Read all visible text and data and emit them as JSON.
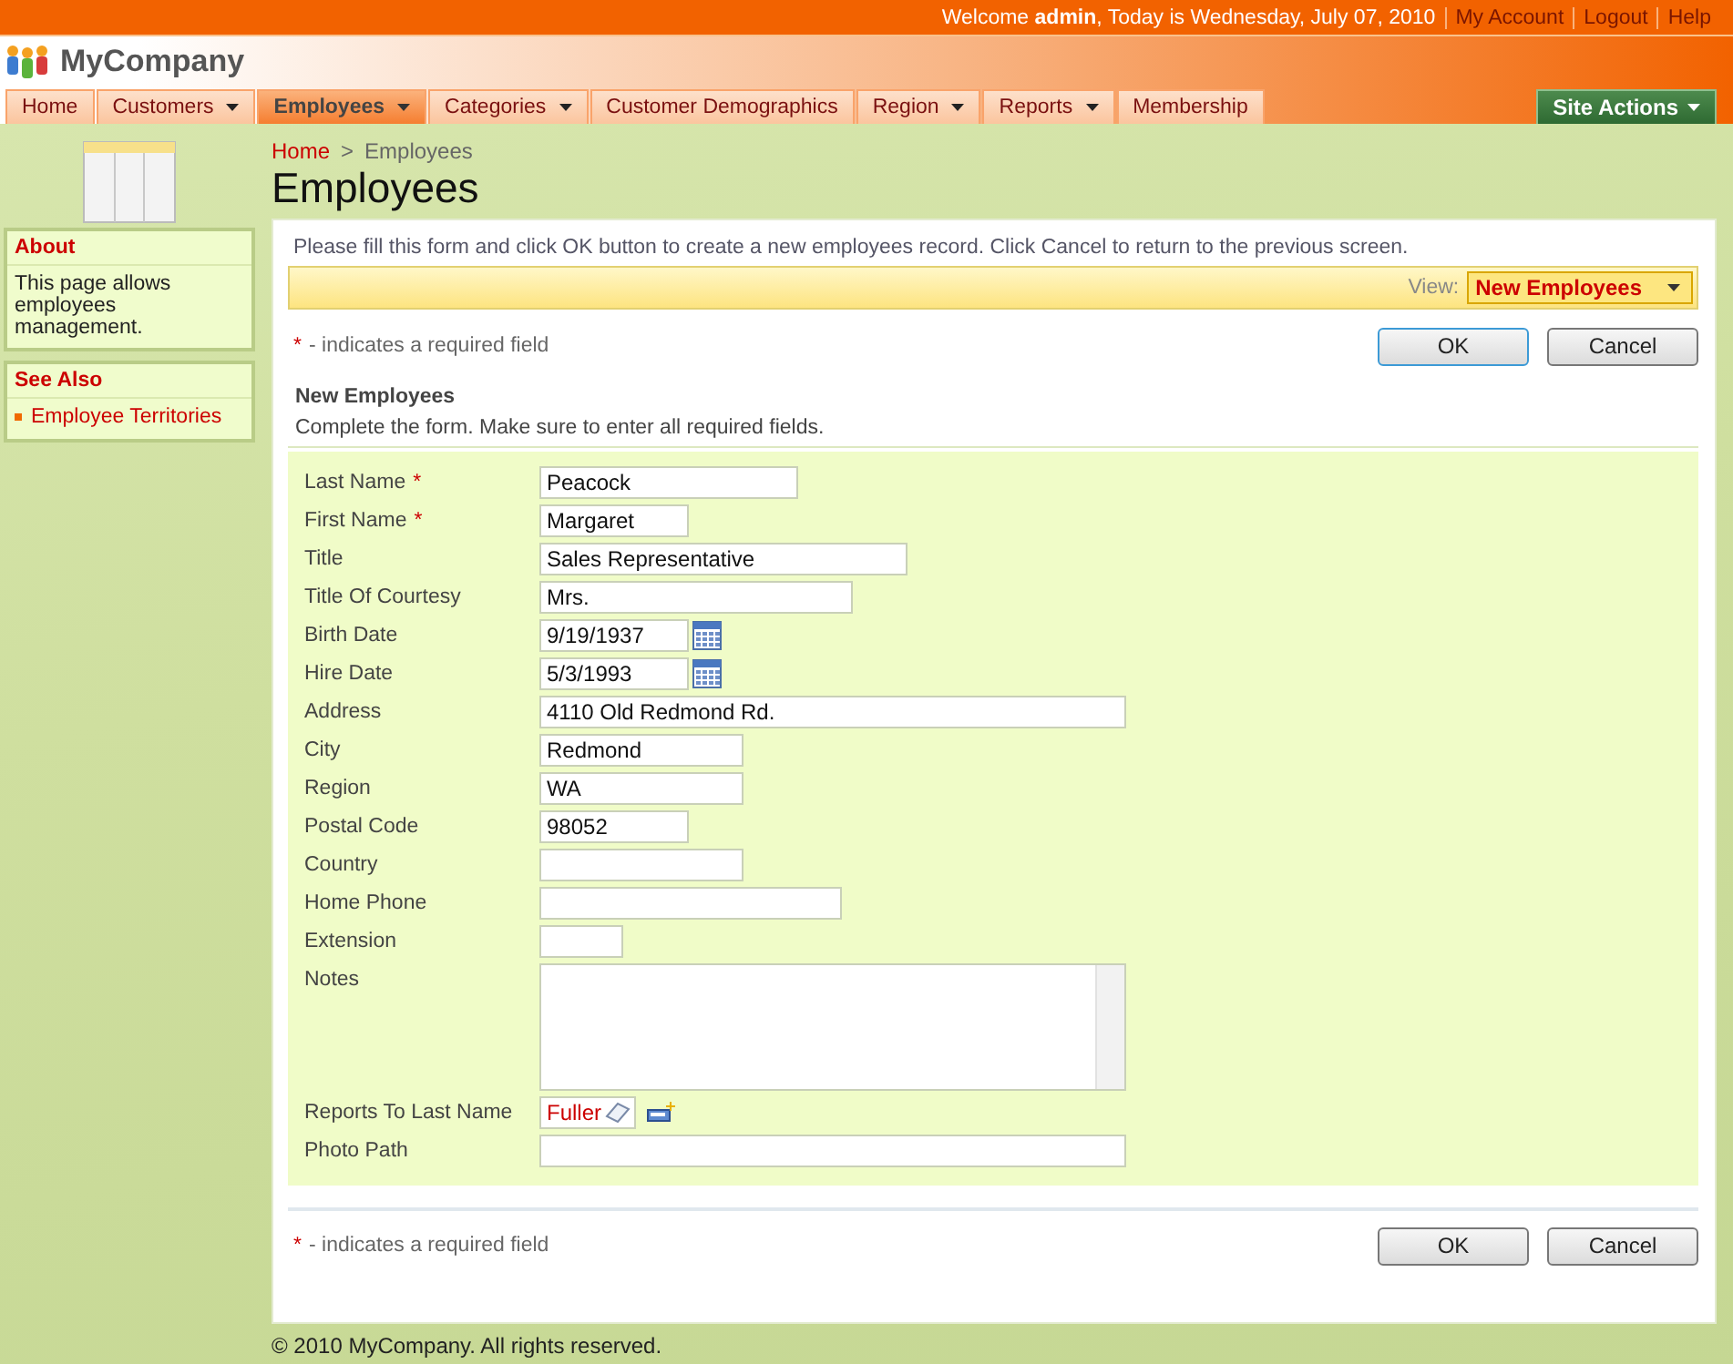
{
  "top_bar": {
    "welcome": "Welcome **admin**, Today is Wednesday, July 07, 2010",
    "links": [
      "My Account",
      "Logout",
      "Help"
    ]
  },
  "logo": {
    "name": "MyCompany"
  },
  "menu": [
    {
      "label": "Home",
      "has_menu": false,
      "selected": false
    },
    {
      "label": "Customers",
      "has_menu": true,
      "selected": false
    },
    {
      "label": "Employees",
      "has_menu": true,
      "selected": true
    },
    {
      "label": "Categories",
      "has_menu": true,
      "selected": false
    },
    {
      "label": "Customer Demographics",
      "has_menu": false,
      "selected": false
    },
    {
      "label": "Region",
      "has_menu": true,
      "selected": false
    },
    {
      "label": "Reports",
      "has_menu": true,
      "selected": false
    },
    {
      "label": "Membership",
      "has_menu": false,
      "selected": false
    }
  ],
  "site_actions": "Site Actions",
  "sidebar": [
    {
      "title": "About",
      "kind": "text",
      "text": "This page allows employees management."
    },
    {
      "title": "See Also",
      "kind": "links",
      "links": [
        "Employee Territories"
      ]
    }
  ],
  "breadcrumb": {
    "items": [
      "Home",
      "Employees"
    ],
    "separator": ">"
  },
  "page_title": "Employees",
  "instructions": "Please fill this form and click OK button to create a new employees record. Click Cancel to return to the previous screen.",
  "view": {
    "label": "View:",
    "value": "New Employees"
  },
  "top_actions": {
    "note": {
      "mark": "*",
      "text": "- indicates a required field"
    },
    "buttons": [
      "OK",
      "Cancel"
    ]
  },
  "form": {
    "title": "New Employees",
    "required_mark": "*",
    "description": "Complete the form. Make sure to enter all required fields.",
    "fields": [
      {
        "label": "Last Name",
        "required": true,
        "kind": "text",
        "value": "Peacock"
      },
      {
        "label": "First Name",
        "required": true,
        "kind": "text",
        "value": "Margaret"
      },
      {
        "label": "Title",
        "required": false,
        "kind": "text",
        "value": "Sales Representative"
      },
      {
        "label": "Title Of Courtesy",
        "required": false,
        "kind": "text",
        "value": "Mrs."
      },
      {
        "label": "Birth Date",
        "required": false,
        "kind": "date",
        "value": "9/19/1937"
      },
      {
        "label": "Hire Date",
        "required": false,
        "kind": "date",
        "value": "5/3/1993"
      },
      {
        "label": "Address",
        "required": false,
        "kind": "text",
        "value": "4110 Old Redmond Rd."
      },
      {
        "label": "City",
        "required": false,
        "kind": "text",
        "value": "Redmond"
      },
      {
        "label": "Region",
        "required": false,
        "kind": "text",
        "value": "WA"
      },
      {
        "label": "Postal Code",
        "required": false,
        "kind": "text",
        "value": "98052"
      },
      {
        "label": "Country",
        "required": false,
        "kind": "text"
      },
      {
        "label": "Home Phone",
        "required": false,
        "kind": "text"
      },
      {
        "label": "Extension",
        "required": false,
        "kind": "text"
      },
      {
        "label": "Notes",
        "required": false,
        "kind": "textarea"
      },
      {
        "label": "Reports To Last Name",
        "required": false,
        "kind": "lookup",
        "value": "Fuller"
      },
      {
        "label": "Photo Path",
        "required": false,
        "kind": "text"
      }
    ]
  },
  "bottom_actions": {
    "note": {
      "mark": "*",
      "text": "- indicates a required field"
    },
    "buttons": [
      "OK",
      "Cancel"
    ]
  },
  "footer": "© 2010 MyCompany. All rights reserved."
}
